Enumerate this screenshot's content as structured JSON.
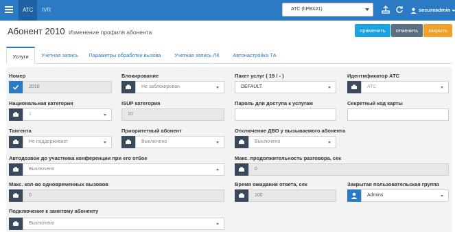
{
  "topbar": {
    "tab_atc": "АТС",
    "tab_ivr": "IVR",
    "pbx_select": "АТС (hPBX#1)",
    "user": "secureadmin"
  },
  "header": {
    "title": "Абонент 2010",
    "subtitle": "Изменение профиля абонента",
    "apply_label": "применить",
    "cancel_label": "отменить",
    "close_label": "закрыть"
  },
  "tabs": [
    "Услуги",
    "Учетная запись",
    "Параметры обработки вызова",
    "Учетная запись ЛК",
    "Автонастройка ТА"
  ],
  "form": {
    "number": {
      "label": "Номер",
      "value": "2010"
    },
    "blocking": {
      "label": "Блокирование",
      "value": "Не заблокирован"
    },
    "service_package": {
      "label": "Пакет услуг   ( 19 / - )",
      "value": "DEFAULT"
    },
    "pbx_id": {
      "label": "Идентификатор АТС",
      "value": "АТС"
    },
    "national_category": {
      "label": "Национальная категория",
      "value": "1"
    },
    "isup_category": {
      "label": "ISUP категория",
      "value": "10"
    },
    "service_password": {
      "label": "Пароль для доступа к услугам",
      "value": ""
    },
    "card_secret": {
      "label": "Секретный код карты",
      "value": ""
    },
    "tangent": {
      "label": "Тангента",
      "value": "Не поддерживает"
    },
    "priority_subscriber": {
      "label": "Приоритетный абонент",
      "value": "Выключено"
    },
    "disable_vas_called": {
      "label": "Отключение ДВО у вызываемого абонента",
      "value": "Выключено"
    },
    "autodial_conference": {
      "label": "Автодозвон до участника конференции при его отбое",
      "value": "Выключено"
    },
    "max_call_duration": {
      "label": "Макс. продолжительность разговора, сек",
      "value": "0"
    },
    "max_simultaneous_calls": {
      "label": "Макс. кол-во одновременных вызовов",
      "value": "0"
    },
    "answer_wait_time": {
      "label": "Время ожидания ответа, сек",
      "value": "100"
    },
    "closed_user_group": {
      "label": "Закрытая пользовательская группа",
      "value": "Admins"
    },
    "connect_busy": {
      "label": "Подключение к занятому абоненту",
      "value": "Выключено"
    }
  }
}
